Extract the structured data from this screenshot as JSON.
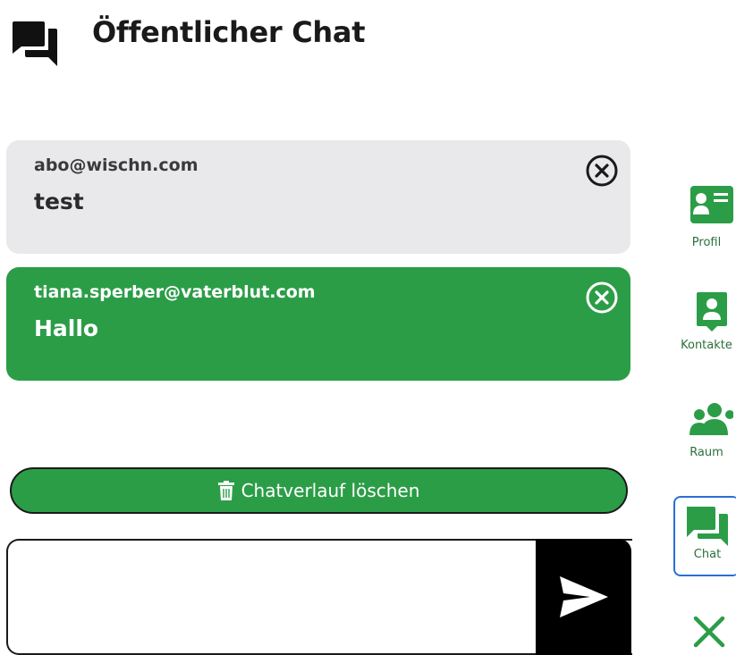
{
  "header": {
    "title": "Öffentlicher Chat",
    "icon": "forum-icon"
  },
  "messages": [
    {
      "sender": "abo@wischn.com",
      "text": "test",
      "style": "own",
      "color": "#e9e9eb"
    },
    {
      "sender": "tiana.sperber@vaterblut.com",
      "text": "Hallo",
      "style": "other",
      "color": "#2b9d47"
    }
  ],
  "actions": {
    "clear_history_label": "Chatverlauf löschen",
    "send_icon": "send-icon"
  },
  "input": {
    "value": "",
    "placeholder": ""
  },
  "sidebar": {
    "items": [
      {
        "label": "Profil",
        "icon": "profile-card-icon"
      },
      {
        "label": "Kontakte",
        "icon": "contacts-icon"
      },
      {
        "label": "Raum",
        "icon": "group-icon"
      },
      {
        "label": "Chat",
        "icon": "chat-icon",
        "active": true
      }
    ],
    "close_icon": "close-icon"
  },
  "colors": {
    "accent_green": "#2b9d47",
    "active_border": "#2a6fd6",
    "dark": "#1a1a1a"
  }
}
